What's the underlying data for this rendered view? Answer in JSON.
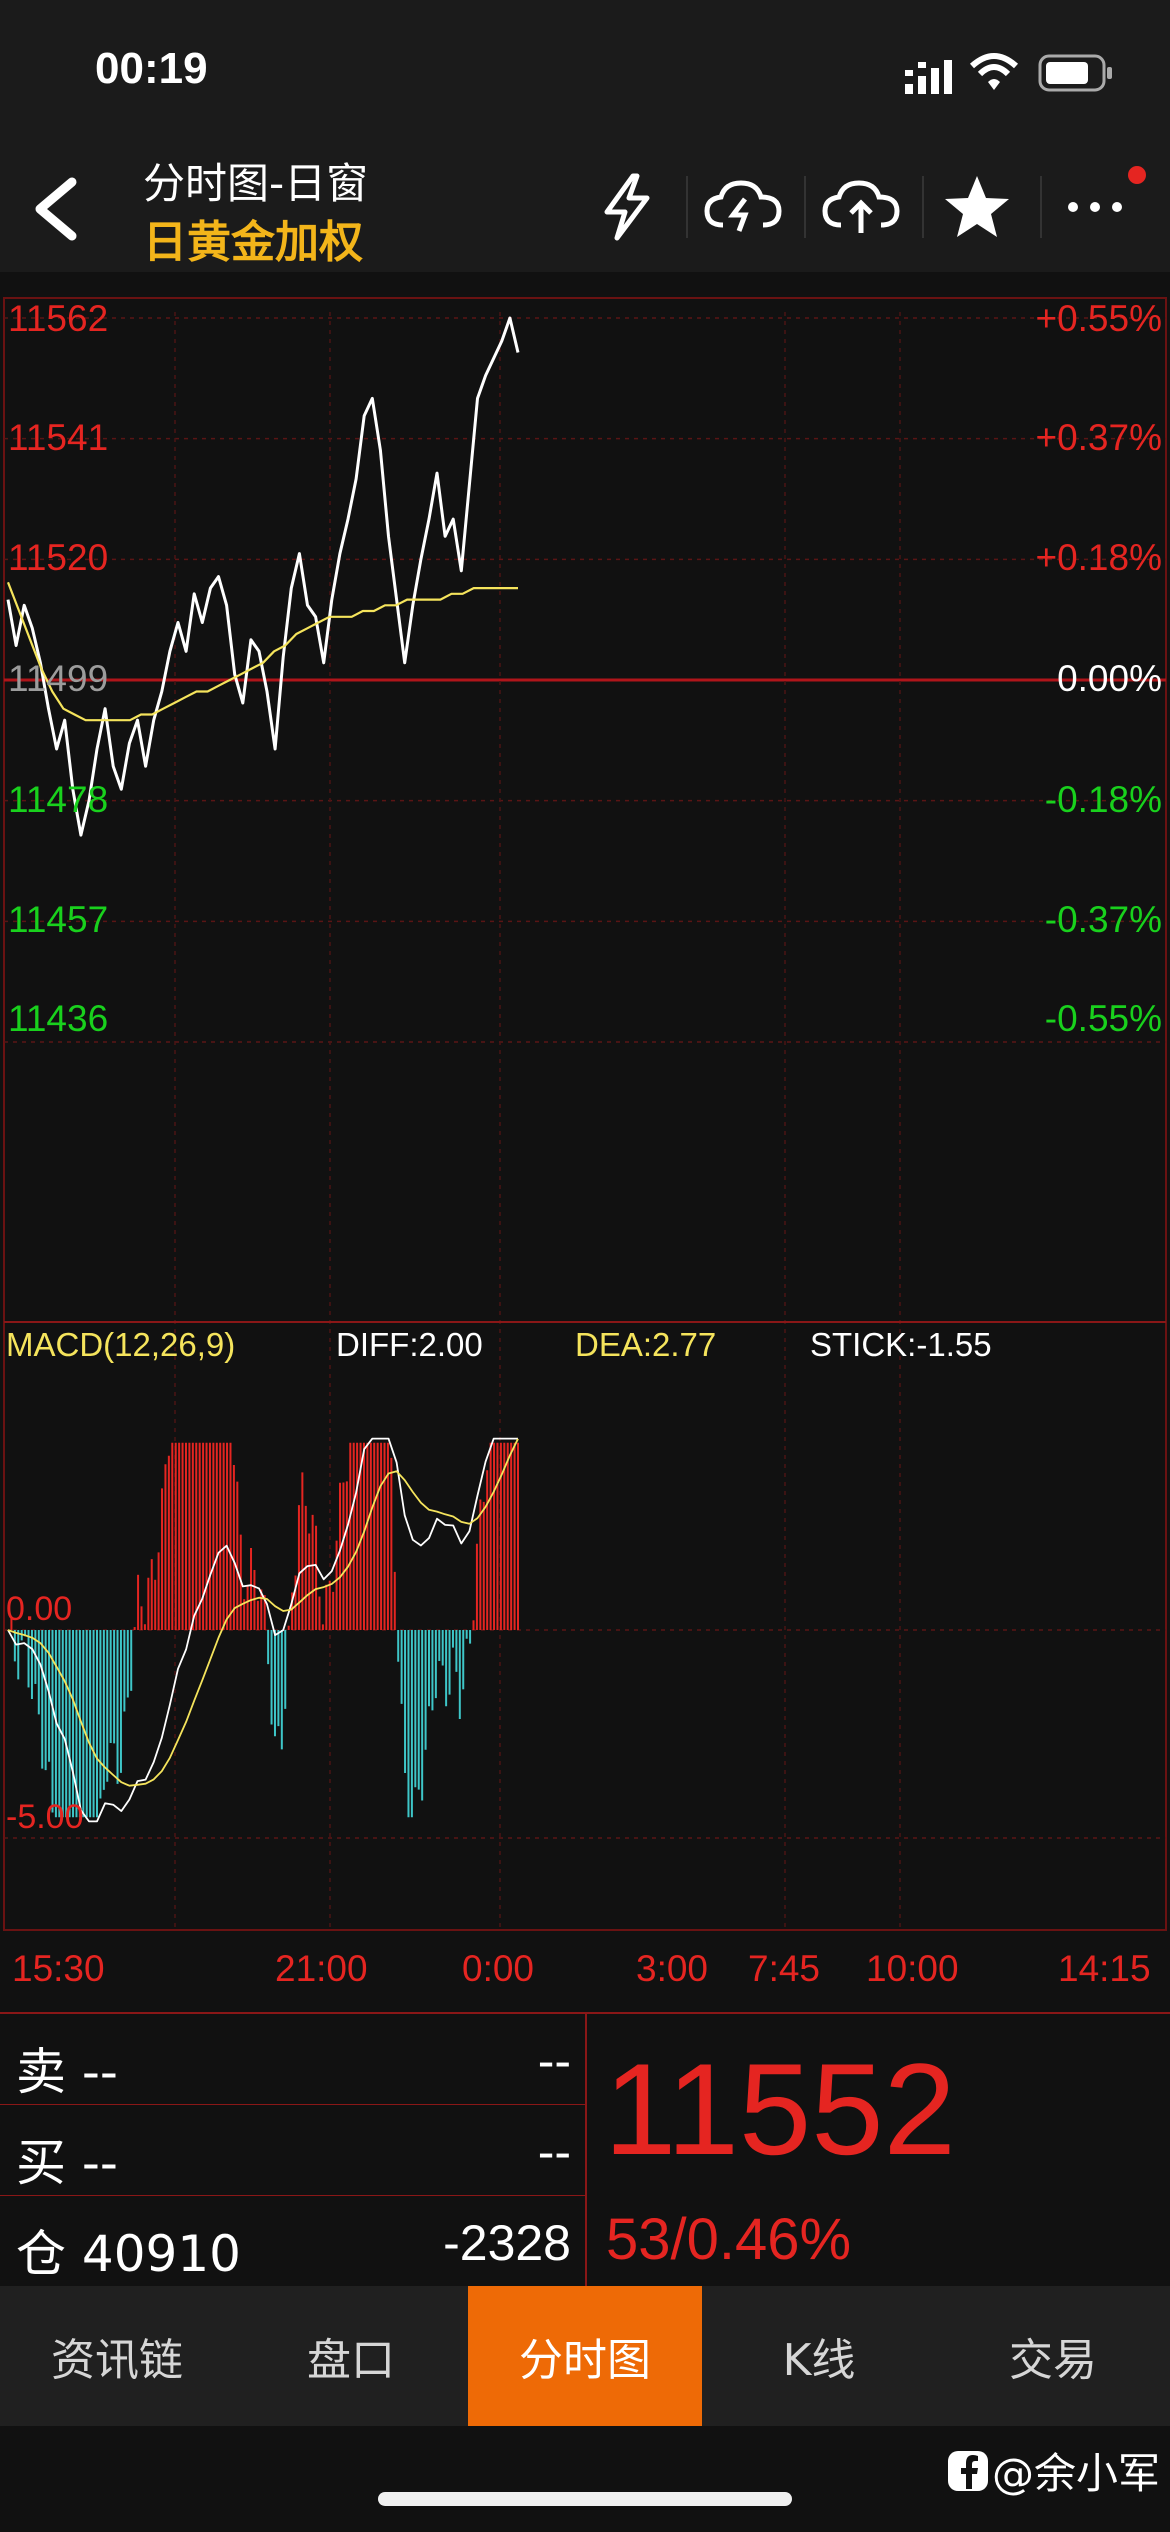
{
  "status": {
    "time": "00:19"
  },
  "header": {
    "title": "分时图-日窗",
    "subtitle": "日黄金加权",
    "icons": [
      "lightning-icon",
      "cloud-lightning-icon",
      "cloud-upload-icon",
      "star-icon",
      "more-icon"
    ]
  },
  "colors": {
    "up": "#e52521",
    "down": "#19d11d",
    "accent": "#ee6a06",
    "title": "#f3b51a",
    "avg_line": "#f5e45c",
    "macd_neg": "#3ec6c8"
  },
  "price_axis": {
    "left": [
      {
        "label": "11562",
        "tone": "red"
      },
      {
        "label": "11541",
        "tone": "red"
      },
      {
        "label": "11520",
        "tone": "red"
      },
      {
        "label": "11499",
        "tone": "gray"
      },
      {
        "label": "11478",
        "tone": "green"
      },
      {
        "label": "11457",
        "tone": "green"
      },
      {
        "label": "11436",
        "tone": "green"
      }
    ],
    "right": [
      {
        "label": "+0.55%",
        "tone": "red"
      },
      {
        "label": "+0.37%",
        "tone": "red"
      },
      {
        "label": "+0.18%",
        "tone": "red"
      },
      {
        "label": "0.00%",
        "tone": "white"
      },
      {
        "label": "-0.18%",
        "tone": "green"
      },
      {
        "label": "-0.37%",
        "tone": "green"
      },
      {
        "label": "-0.55%",
        "tone": "green"
      }
    ]
  },
  "macd": {
    "label": "MACD(12,26,9)",
    "diff": "DIFF:2.00",
    "dea": "DEA:2.77",
    "stick": "STICK:-1.55",
    "axis": [
      "0.00",
      "-5.00"
    ]
  },
  "time_axis": [
    "15:30",
    "21:00",
    "0:00",
    "3:00",
    "7:45",
    "10:00",
    "14:15"
  ],
  "chart_data": {
    "type": "line",
    "ylim": [
      11436,
      11562
    ],
    "prev_close": 11499,
    "series": [
      {
        "values": [
          11513,
          11505,
          11512,
          11508,
          11502,
          11494,
          11487,
          11492,
          11480,
          11472,
          11478,
          11487,
          11494,
          11484,
          11480,
          11488,
          11492,
          11484,
          11492,
          11497,
          11504,
          11509,
          11504,
          11514,
          11509,
          11515,
          11517,
          11512,
          11500,
          11495,
          11506,
          11504,
          11497,
          11487,
          11503,
          11515,
          11521,
          11512,
          11510,
          11502,
          11513,
          11521,
          11527,
          11534,
          11545,
          11548,
          11539,
          11524,
          11513,
          11502,
          11512,
          11520,
          11527,
          11535,
          11524,
          11527,
          11518,
          11533,
          11548,
          11552,
          11555,
          11558,
          11562,
          11556
        ]
      },
      {
        "values": [
          11516,
          11511,
          11506,
          11501,
          11497,
          11494,
          11493,
          11492,
          11492,
          11492,
          11492,
          11492,
          11493,
          11493,
          11494,
          11495,
          11496,
          11497,
          11497,
          11498,
          11499,
          11500,
          11501,
          11502,
          11504,
          11505,
          11507,
          11508,
          11509,
          11510,
          11510,
          11510,
          11511,
          11511,
          11512,
          11512,
          11513,
          11513,
          11513,
          11513,
          11514,
          11514,
          11515,
          11515,
          11515,
          11515,
          11515
        ]
      }
    ]
  },
  "quote": {
    "sell_label": "卖 --",
    "sell_value": "--",
    "buy_label": "买 --",
    "buy_value": "--",
    "oi_label": "仓 40910",
    "oi_value": "-2328",
    "last": "11552",
    "change": "53/0.46%"
  },
  "tabs": [
    {
      "label": "资讯链",
      "name": "tab-news"
    },
    {
      "label": "盘口",
      "name": "tab-orderbook"
    },
    {
      "label": "分时图",
      "name": "tab-intraday",
      "active": true
    },
    {
      "label": "K线",
      "name": "tab-kline"
    },
    {
      "label": "交易",
      "name": "tab-trade"
    }
  ],
  "watermark": "@余小军"
}
